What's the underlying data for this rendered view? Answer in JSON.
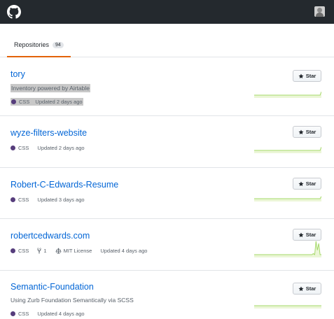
{
  "header": {
    "logo_icon": "github-mark-icon",
    "avatar_icon": "user-avatar"
  },
  "tabs": [
    {
      "label": "Repositories",
      "count": "94"
    }
  ],
  "repos": [
    {
      "name": "tory",
      "description": "Inventory powered by Airtable",
      "language": "CSS",
      "language_color": "#563d7c",
      "updated": "Updated 2 days ago",
      "star_label": "Star",
      "activity": [
        0,
        0,
        0,
        0,
        0,
        0,
        0,
        0,
        0,
        0,
        0,
        0,
        0,
        0,
        0,
        0,
        0,
        0,
        0,
        0,
        0,
        0,
        0,
        0,
        0,
        0,
        0,
        0,
        0,
        0,
        0,
        0,
        0,
        0,
        0,
        0,
        0,
        0,
        0,
        0,
        0,
        0,
        0,
        0,
        0,
        0,
        0,
        0,
        0,
        0,
        3
      ]
    },
    {
      "name": "wyze-filters-website",
      "description": "",
      "language": "CSS",
      "language_color": "#563d7c",
      "updated": "Updated 2 days ago",
      "star_label": "Star",
      "activity": [
        0,
        0,
        0,
        0,
        0,
        0,
        0,
        0,
        0,
        0,
        0,
        0,
        0,
        0,
        0,
        0,
        0,
        0,
        0,
        0,
        0,
        0,
        0,
        0,
        0,
        0,
        0,
        0,
        0,
        0,
        0,
        0,
        0,
        0,
        0,
        0,
        0,
        0,
        0,
        0,
        0,
        0,
        0,
        0,
        0,
        0,
        0,
        0,
        0,
        0,
        3
      ]
    },
    {
      "name": "Robert-C-Edwards-Resume",
      "description": "",
      "language": "CSS",
      "language_color": "#563d7c",
      "updated": "Updated 3 days ago",
      "star_label": "Star",
      "activity": [
        0,
        0,
        0,
        0,
        0,
        0,
        0,
        0,
        0,
        0,
        0,
        0,
        0,
        0,
        0,
        0,
        0,
        0,
        0,
        0,
        0,
        0,
        0,
        0,
        0,
        0,
        0,
        0,
        0,
        0,
        0,
        0,
        0,
        0,
        0,
        0,
        0,
        0,
        0,
        0,
        0,
        0,
        0,
        0,
        0,
        0,
        0,
        0,
        0,
        0,
        2
      ]
    },
    {
      "name": "robertcedwards.com",
      "description": "",
      "language": "CSS",
      "language_color": "#563d7c",
      "forks": "1",
      "license": "MIT License",
      "updated": "Updated 4 days ago",
      "star_label": "Star",
      "activity": [
        0,
        0,
        0,
        0,
        0,
        0,
        0,
        0,
        0,
        0,
        0,
        0,
        0,
        0,
        0,
        0,
        0,
        0,
        0,
        0,
        0,
        0,
        0,
        0,
        0,
        0,
        0,
        0,
        0,
        0,
        0,
        0,
        0,
        0,
        0,
        0,
        0,
        0,
        0,
        0,
        0,
        0,
        0,
        0,
        1,
        0,
        12,
        4,
        10,
        0,
        0
      ]
    },
    {
      "name": "Semantic-Foundation",
      "description": "Using Zurb Foundation Semantically via SCSS",
      "language": "CSS",
      "language_color": "#563d7c",
      "updated": "Updated 4 days ago",
      "star_label": "Star",
      "activity": [
        0,
        0,
        0,
        0,
        0,
        0,
        0,
        0,
        0,
        0,
        0,
        0,
        0,
        0,
        0,
        0,
        0,
        0,
        0,
        0,
        0,
        0,
        0,
        0,
        0,
        0,
        0,
        0,
        0,
        0,
        0,
        0,
        0,
        0,
        0,
        0,
        0,
        0,
        0,
        0,
        0,
        0,
        0,
        0,
        0,
        0,
        0,
        0,
        0,
        0,
        0
      ]
    }
  ]
}
